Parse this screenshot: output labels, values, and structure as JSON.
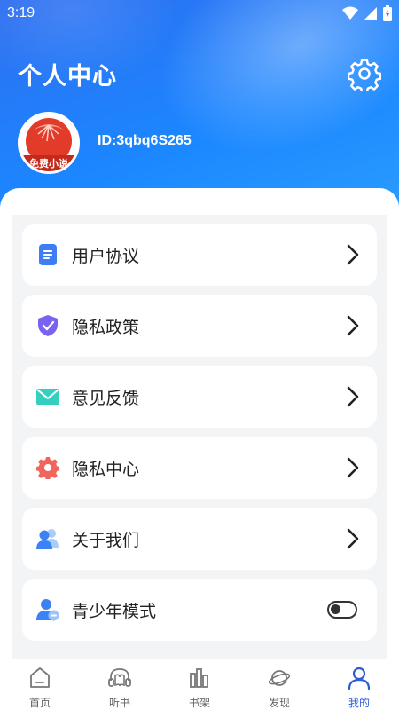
{
  "status_bar": {
    "time": "3:19"
  },
  "header": {
    "title": "个人中心",
    "settings_icon": "gear-icon"
  },
  "profile": {
    "avatar_text": "免费小说",
    "user_id": "ID:3qbq6S265"
  },
  "menu": {
    "items": [
      {
        "label": "用户协议",
        "icon": "document-icon"
      },
      {
        "label": "隐私政策",
        "icon": "shield-check-icon"
      },
      {
        "label": "意见反馈",
        "icon": "envelope-icon"
      },
      {
        "label": "隐私中心",
        "icon": "gear-icon"
      },
      {
        "label": "关于我们",
        "icon": "users-icon"
      },
      {
        "label": "青少年模式",
        "icon": "user-minus-icon",
        "toggle_on": false
      }
    ]
  },
  "tabbar": {
    "items": [
      {
        "label": "首页",
        "icon": "home-icon",
        "active": false
      },
      {
        "label": "听书",
        "icon": "headphone-book-icon",
        "active": false
      },
      {
        "label": "书架",
        "icon": "bookshelf-icon",
        "active": false
      },
      {
        "label": "发现",
        "icon": "planet-icon",
        "active": false
      },
      {
        "label": "我的",
        "icon": "person-icon",
        "active": true
      }
    ]
  },
  "colors": {
    "header_blue": "#1b86ff",
    "accent": "#2e5bd6",
    "toggle": "#333333"
  }
}
